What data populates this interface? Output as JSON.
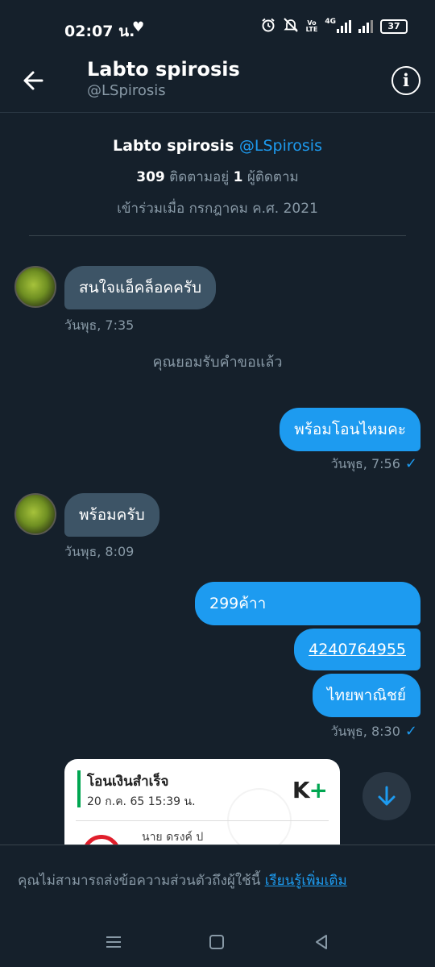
{
  "status": {
    "time": "02:07 น.",
    "heart": "♥",
    "network": "4G",
    "volte_top": "Vo",
    "volte_bottom": "LTE",
    "battery": "37"
  },
  "header": {
    "name": "Labto spirosis",
    "handle": "@LSpirosis"
  },
  "profile": {
    "name": "Labto spirosis",
    "handle": "@LSpirosis",
    "following_count": "309",
    "following_label": "ติดตามอยู่",
    "followers_count": "1",
    "followers_label": "ผู้ติดตาม",
    "joined": "เข้าร่วมเมื่อ กรกฎาคม ค.ศ. 2021"
  },
  "messages": {
    "m1": {
      "text": "สนใจแอ็คล็อคครับ",
      "time": "วันพุธ, 7:35"
    },
    "system": "คุณยอมรับคำขอแล้ว",
    "m2": {
      "text": "พร้อมโอนไหมคะ",
      "time": "วันพุธ, 7:56"
    },
    "m3": {
      "text": "พร้อมครับ",
      "time": "วันพุธ, 8:09"
    },
    "m4a": "299ค้าา",
    "m4b": "4240764955",
    "m4c": "ไทยพาณิชย์",
    "m4_time": "วันพุธ, 8:30"
  },
  "slip": {
    "title": "โอนเงินสำเร็จ",
    "date": "20 ก.ค. 65  15:39 น.",
    "logo_k": "K",
    "logo_plus": "+",
    "name_partial": "นาย ดรงค์ ป"
  },
  "footer": {
    "text": "คุณไม่สามารถส่งข้อความส่วนตัวถึงผู้ใช้นี้",
    "link": "เรียนรู้เพิ่มเติม"
  },
  "colors": {
    "background": "#15202b",
    "accent": "#1d9bf0",
    "incoming_bubble": "#3d5466",
    "muted_text": "#8899a6"
  },
  "icons": {
    "back": "arrow-left-icon",
    "info": "info-icon",
    "scroll": "arrow-down-icon",
    "alarm": "alarm-icon",
    "mute": "bell-off-icon"
  }
}
